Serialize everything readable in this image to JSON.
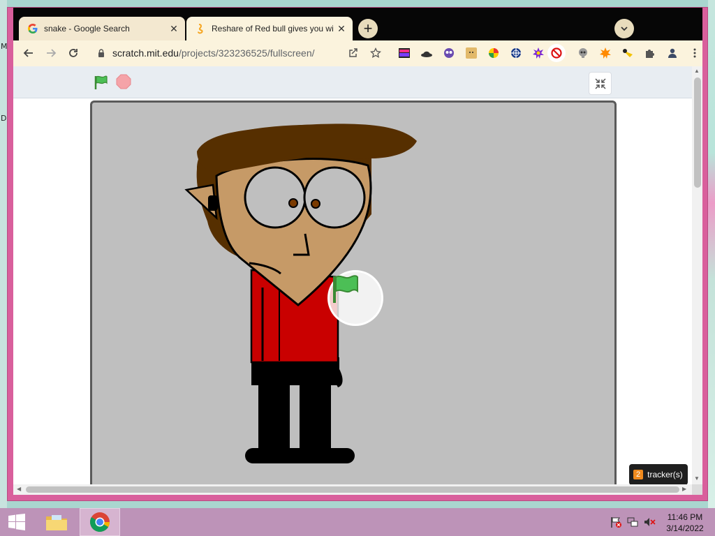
{
  "desktop": {
    "left_fragments": [
      "M",
      "D"
    ]
  },
  "browser": {
    "tabs": [
      {
        "title": "snake - Google Search",
        "favicon": "google-g-icon",
        "active": false
      },
      {
        "title": "Reshare of Red bull gives you wings",
        "favicon": "scratch-cat-icon",
        "active": true
      }
    ],
    "new_tab_label": "+",
    "address": {
      "host": "scratch.mit.edu",
      "path": "/projects/323236525/fullscreen/"
    },
    "toolbar_icons": [
      "share-icon",
      "bookmark-star-icon",
      "extension-1-icon",
      "extension-hat-icon",
      "extension-owl-icon",
      "extension-doge-icon",
      "extension-color-icon",
      "extension-globe-icon",
      "extension-burst-icon",
      "extension-block-icon",
      "extension-skull-icon",
      "extension-flame-icon",
      "extension-duck-icon",
      "extensions-puzzle-icon",
      "profile-icon",
      "more-vert-icon"
    ]
  },
  "player": {
    "controls": [
      "green-flag-icon",
      "stop-sign-icon",
      "unfullscreen-icon"
    ]
  },
  "tracker": {
    "count": "2",
    "label": "tracker(s)"
  },
  "taskbar": {
    "apps": [
      "windows-start-icon",
      "file-explorer-icon",
      "chrome-icon"
    ],
    "clock": {
      "time": "11:46 PM",
      "date": "3/14/2022"
    }
  },
  "colors": {
    "window_frame": "#d95f9c",
    "tab_strip": "#060606",
    "toolbar": "#fbf3dd",
    "stage_bg": "#bfbfbf",
    "taskbar": "#bd93b8",
    "shirt": "#c90000",
    "hair": "#562f00",
    "skin": "#c69a67"
  }
}
